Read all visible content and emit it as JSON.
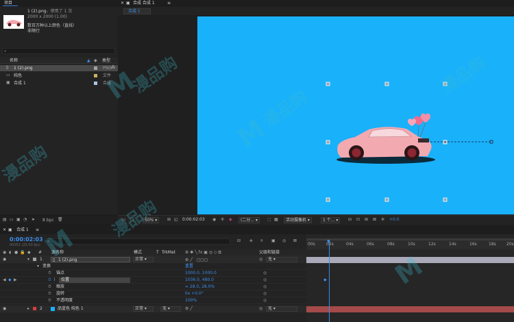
{
  "project_panel": {
    "tab_label": "项目",
    "asset_name": "1 (2).png",
    "asset_used": "，使用了 1 次",
    "asset_dims": "2000 x 2000 (1.00)",
    "asset_color": "数百万种以上颜色（直线）",
    "asset_interp": "非隔行",
    "search_icon": "⌕",
    "columns": {
      "name": "名称",
      "type": "类型"
    },
    "items": [
      {
        "name": "1 (2).png",
        "type": "PNG",
        "color": "#9ea3a8"
      },
      {
        "name": "纯色",
        "type": "文件",
        "color": "#c9b25c"
      },
      {
        "name": "合成 1",
        "type": "合成",
        "color": "#a9c6e3"
      }
    ],
    "bpc": "8 bpc"
  },
  "viewer": {
    "tab_label": "合成 合成 1",
    "tab_menu": "≡",
    "breadcrumb": "合成 1",
    "zoom": "50%",
    "timecode": "0:00:02:03",
    "resolution": "(二分...",
    "camera": "活动摄像机",
    "views": "1 个...",
    "exposure": "+0.0",
    "bg_color": "#19b1fa"
  },
  "timeline": {
    "tab_label": "合成 1",
    "timecode": "0:00:02:03",
    "fps": "00051 (25.00 fps)",
    "search_icon": "⌕",
    "columns": {
      "num": "#",
      "source": "源名称",
      "mode": "模式",
      "t": "T",
      "trkmat": "TrkMat",
      "parent": "父级和链接"
    },
    "ruler_ticks": [
      "00s",
      "02s",
      "04s",
      "06s",
      "08s",
      "10s",
      "12s",
      "14s",
      "16s",
      "18s",
      "20s"
    ],
    "layer1": {
      "num": "1",
      "name": "1 (2).png",
      "mode": "正常",
      "parent": "无"
    },
    "transform_label": "变换",
    "reset_label": "重置",
    "props": [
      {
        "name": "锚点",
        "value": "1000.0, 1000.0"
      },
      {
        "name": "位置",
        "value": "1036.0, 480.0"
      },
      {
        "name": "缩放",
        "value": "∞ 28.0, 28.0%"
      },
      {
        "name": "旋转",
        "value": "0x +0.0°"
      },
      {
        "name": "不透明度",
        "value": "100%"
      }
    ],
    "layer2": {
      "num": "2",
      "name": "品蓝色 纯色 1",
      "mode": "正常",
      "trkmat": "无",
      "parent": "无",
      "color": "#d44040"
    }
  },
  "watermark": {
    "text": "漫品购",
    "mark": "M"
  }
}
